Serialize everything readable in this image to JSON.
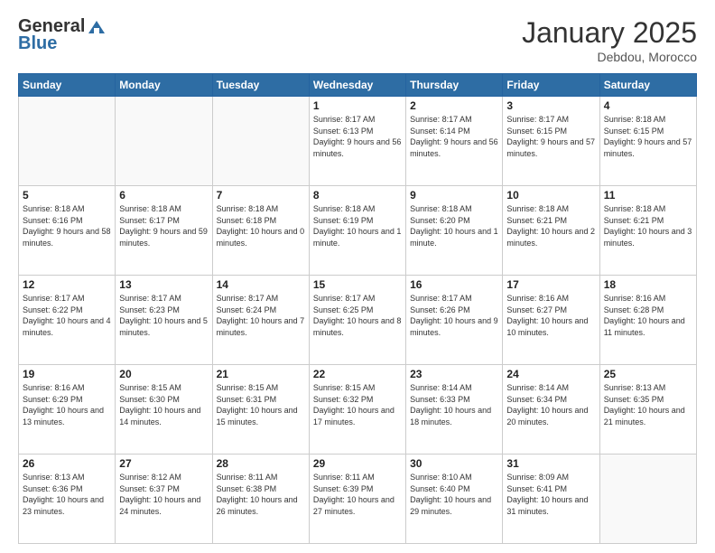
{
  "header": {
    "logo_general": "General",
    "logo_blue": "Blue",
    "month_title": "January 2025",
    "location": "Debdou, Morocco"
  },
  "days_of_week": [
    "Sunday",
    "Monday",
    "Tuesday",
    "Wednesday",
    "Thursday",
    "Friday",
    "Saturday"
  ],
  "weeks": [
    [
      {
        "day": "",
        "info": ""
      },
      {
        "day": "",
        "info": ""
      },
      {
        "day": "",
        "info": ""
      },
      {
        "day": "1",
        "info": "Sunrise: 8:17 AM\nSunset: 6:13 PM\nDaylight: 9 hours and 56 minutes."
      },
      {
        "day": "2",
        "info": "Sunrise: 8:17 AM\nSunset: 6:14 PM\nDaylight: 9 hours and 56 minutes."
      },
      {
        "day": "3",
        "info": "Sunrise: 8:17 AM\nSunset: 6:15 PM\nDaylight: 9 hours and 57 minutes."
      },
      {
        "day": "4",
        "info": "Sunrise: 8:18 AM\nSunset: 6:15 PM\nDaylight: 9 hours and 57 minutes."
      }
    ],
    [
      {
        "day": "5",
        "info": "Sunrise: 8:18 AM\nSunset: 6:16 PM\nDaylight: 9 hours and 58 minutes."
      },
      {
        "day": "6",
        "info": "Sunrise: 8:18 AM\nSunset: 6:17 PM\nDaylight: 9 hours and 59 minutes."
      },
      {
        "day": "7",
        "info": "Sunrise: 8:18 AM\nSunset: 6:18 PM\nDaylight: 10 hours and 0 minutes."
      },
      {
        "day": "8",
        "info": "Sunrise: 8:18 AM\nSunset: 6:19 PM\nDaylight: 10 hours and 1 minute."
      },
      {
        "day": "9",
        "info": "Sunrise: 8:18 AM\nSunset: 6:20 PM\nDaylight: 10 hours and 1 minute."
      },
      {
        "day": "10",
        "info": "Sunrise: 8:18 AM\nSunset: 6:21 PM\nDaylight: 10 hours and 2 minutes."
      },
      {
        "day": "11",
        "info": "Sunrise: 8:18 AM\nSunset: 6:21 PM\nDaylight: 10 hours and 3 minutes."
      }
    ],
    [
      {
        "day": "12",
        "info": "Sunrise: 8:17 AM\nSunset: 6:22 PM\nDaylight: 10 hours and 4 minutes."
      },
      {
        "day": "13",
        "info": "Sunrise: 8:17 AM\nSunset: 6:23 PM\nDaylight: 10 hours and 5 minutes."
      },
      {
        "day": "14",
        "info": "Sunrise: 8:17 AM\nSunset: 6:24 PM\nDaylight: 10 hours and 7 minutes."
      },
      {
        "day": "15",
        "info": "Sunrise: 8:17 AM\nSunset: 6:25 PM\nDaylight: 10 hours and 8 minutes."
      },
      {
        "day": "16",
        "info": "Sunrise: 8:17 AM\nSunset: 6:26 PM\nDaylight: 10 hours and 9 minutes."
      },
      {
        "day": "17",
        "info": "Sunrise: 8:16 AM\nSunset: 6:27 PM\nDaylight: 10 hours and 10 minutes."
      },
      {
        "day": "18",
        "info": "Sunrise: 8:16 AM\nSunset: 6:28 PM\nDaylight: 10 hours and 11 minutes."
      }
    ],
    [
      {
        "day": "19",
        "info": "Sunrise: 8:16 AM\nSunset: 6:29 PM\nDaylight: 10 hours and 13 minutes."
      },
      {
        "day": "20",
        "info": "Sunrise: 8:15 AM\nSunset: 6:30 PM\nDaylight: 10 hours and 14 minutes."
      },
      {
        "day": "21",
        "info": "Sunrise: 8:15 AM\nSunset: 6:31 PM\nDaylight: 10 hours and 15 minutes."
      },
      {
        "day": "22",
        "info": "Sunrise: 8:15 AM\nSunset: 6:32 PM\nDaylight: 10 hours and 17 minutes."
      },
      {
        "day": "23",
        "info": "Sunrise: 8:14 AM\nSunset: 6:33 PM\nDaylight: 10 hours and 18 minutes."
      },
      {
        "day": "24",
        "info": "Sunrise: 8:14 AM\nSunset: 6:34 PM\nDaylight: 10 hours and 20 minutes."
      },
      {
        "day": "25",
        "info": "Sunrise: 8:13 AM\nSunset: 6:35 PM\nDaylight: 10 hours and 21 minutes."
      }
    ],
    [
      {
        "day": "26",
        "info": "Sunrise: 8:13 AM\nSunset: 6:36 PM\nDaylight: 10 hours and 23 minutes."
      },
      {
        "day": "27",
        "info": "Sunrise: 8:12 AM\nSunset: 6:37 PM\nDaylight: 10 hours and 24 minutes."
      },
      {
        "day": "28",
        "info": "Sunrise: 8:11 AM\nSunset: 6:38 PM\nDaylight: 10 hours and 26 minutes."
      },
      {
        "day": "29",
        "info": "Sunrise: 8:11 AM\nSunset: 6:39 PM\nDaylight: 10 hours and 27 minutes."
      },
      {
        "day": "30",
        "info": "Sunrise: 8:10 AM\nSunset: 6:40 PM\nDaylight: 10 hours and 29 minutes."
      },
      {
        "day": "31",
        "info": "Sunrise: 8:09 AM\nSunset: 6:41 PM\nDaylight: 10 hours and 31 minutes."
      },
      {
        "day": "",
        "info": ""
      }
    ]
  ]
}
